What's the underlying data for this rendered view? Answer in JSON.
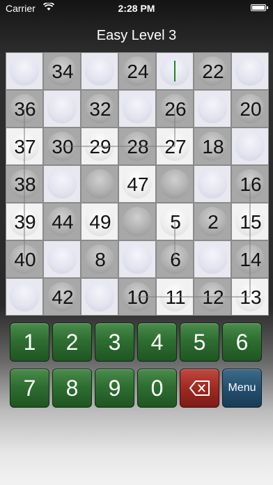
{
  "status_bar": {
    "carrier": "Carrier",
    "time": "2:28 PM"
  },
  "level_title": "Easy Level 3",
  "board": {
    "rows": [
      [
        null,
        34,
        null,
        24,
        null,
        22,
        null
      ],
      [
        36,
        null,
        32,
        null,
        26,
        null,
        20
      ],
      [
        37,
        30,
        29,
        28,
        27,
        18,
        null
      ],
      [
        38,
        null,
        null,
        47,
        null,
        null,
        16
      ],
      [
        39,
        44,
        49,
        null,
        5,
        2,
        15
      ],
      [
        40,
        null,
        8,
        null,
        6,
        null,
        14
      ],
      [
        null,
        42,
        null,
        10,
        11,
        12,
        13
      ]
    ],
    "cursor_cell": [
      0,
      4
    ],
    "colors": {
      "cursor": "#1c8a1c",
      "empty_highlight": "#e8e8f0"
    }
  },
  "keypad": {
    "rows": [
      [
        "1",
        "2",
        "3",
        "4",
        "5",
        "6"
      ],
      [
        "7",
        "8",
        "9",
        "0",
        "backspace-icon",
        "Menu"
      ]
    ],
    "colors": {
      "number_key": "#2e6e31",
      "delete_key": "#9e2a22",
      "menu_key": "#24506f"
    }
  }
}
